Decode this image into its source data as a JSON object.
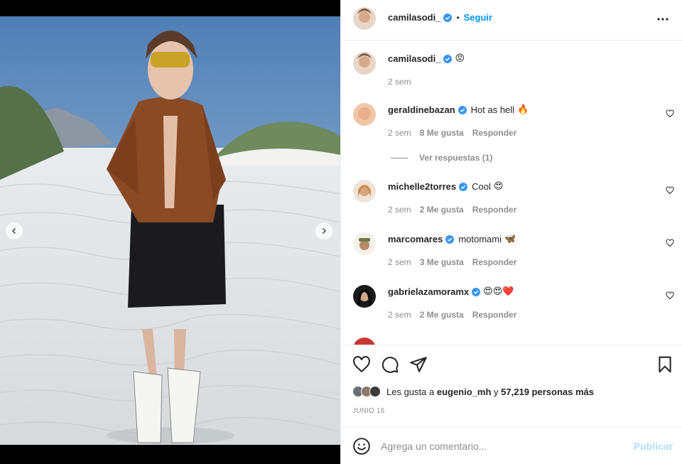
{
  "post": {
    "author": "camilasodi_",
    "follow_label": "Seguir",
    "separator": "•",
    "caption_emoji": "😡"
  },
  "comments": [
    {
      "user": "camilasodi_",
      "text": "",
      "emojis": "😡",
      "time": "2 sem"
    },
    {
      "user": "geraldinebazan",
      "text": "Hot as hell",
      "emojis": "🔥",
      "time": "2 sem",
      "likes": "8 Me gusta",
      "reply_label": "Responder",
      "view_replies": "Ver respuestas (1)"
    },
    {
      "user": "michelle2torres",
      "text": "Cool",
      "emojis": "😍",
      "time": "2 sem",
      "likes": "2 Me gusta",
      "reply_label": "Responder"
    },
    {
      "user": "marcomares",
      "text": "motomami",
      "emojis": "🦋",
      "time": "2 sem",
      "likes": "3 Me gusta",
      "reply_label": "Responder"
    },
    {
      "user": "gabrielazamoramx",
      "text": "",
      "emojis": "😍😍❤️",
      "time": "2 sem",
      "likes": "2 Me gusta",
      "reply_label": "Responder"
    }
  ],
  "likes_summary": {
    "prefix": "Les gusta a",
    "user": "eugenio_mh",
    "conjunction": "y",
    "count": "57,219 personas más"
  },
  "date": "JUNIO 16",
  "add_comment": {
    "placeholder": "Agrega un comentario...",
    "publish_label": "Publicar"
  },
  "colors": {
    "accent": "#0095f6",
    "verified": "#3897f0",
    "publish_disabled": "#b2dffc",
    "muted": "#8e8e8e"
  },
  "icons": [
    "chevron-left-icon",
    "chevron-right-icon",
    "more-icon",
    "verified-icon",
    "heart-icon",
    "comment-icon",
    "share-icon",
    "bookmark-icon",
    "emoji-icon"
  ]
}
